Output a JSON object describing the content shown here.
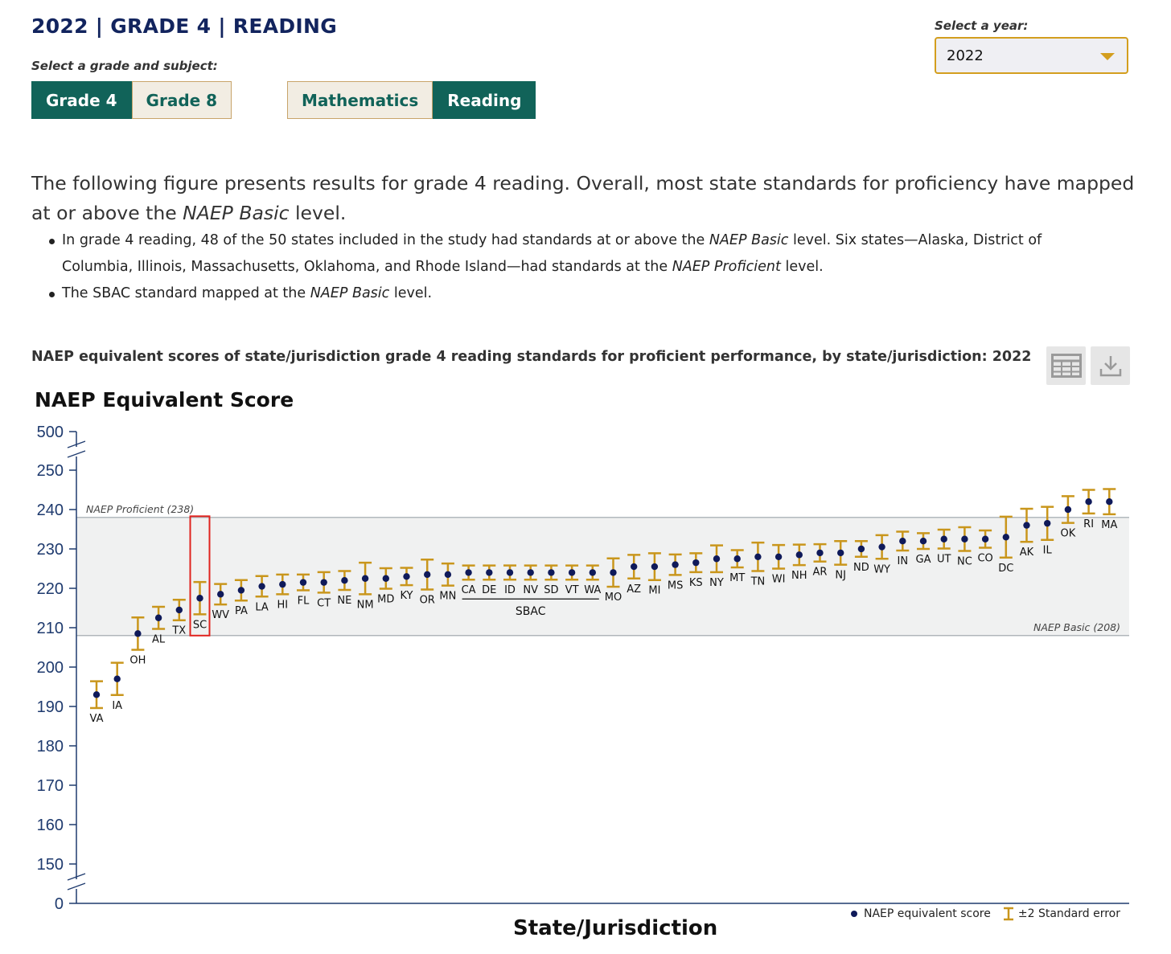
{
  "header": {
    "title": "2022 | GRADE 4 | READING",
    "grade_subject_label": "Select a grade and subject:",
    "year_label": "Select a year:",
    "year_value": "2022",
    "grades": [
      {
        "label": "Grade 4",
        "active": true
      },
      {
        "label": "Grade 8",
        "active": false
      }
    ],
    "subjects": [
      {
        "label": "Mathematics",
        "active": false
      },
      {
        "label": "Reading",
        "active": true
      }
    ]
  },
  "intro": {
    "text_before": "The following figure presents results for grade 4 reading. Overall, most state standards for proficiency have mapped at or above the ",
    "text_em": "NAEP Basic",
    "text_after": " level.",
    "bullet1_a": "In grade 4 reading, 48 of the 50 states included in the study had standards at or above the ",
    "bullet1_em1": "NAEP Basic",
    "bullet1_b": " level. Six states—Alaska, District of Columbia, Illinois, Massachusetts, Oklahoma, and Rhode Island—had standards at the ",
    "bullet1_em2": "NAEP Proficient",
    "bullet1_c": " level.",
    "bullet2_a": "The SBAC standard mapped at the ",
    "bullet2_em": "NAEP Basic",
    "bullet2_b": " level."
  },
  "figure": {
    "caption": "NAEP equivalent scores of state/jurisdiction grade 4 reading standards for proficient performance, by state/jurisdiction: 2022",
    "table_icon": "table-icon",
    "download_icon": "download-icon"
  },
  "colors": {
    "point": "#0f1a5a",
    "error_bar": "#c9961c",
    "band": "#f0f1f1",
    "axis": "#1e3a6e",
    "highlight": "#e0231f"
  },
  "chart_data": {
    "type": "scatter",
    "title": "",
    "ylabel": "NAEP Equivalent Score",
    "xlabel": "State/Jurisdiction",
    "ylim": [
      0,
      500
    ],
    "y_axis_break": true,
    "y_ticks": [
      0,
      150,
      160,
      170,
      180,
      190,
      200,
      210,
      220,
      230,
      240,
      250,
      500
    ],
    "reference_lines": [
      {
        "label": "NAEP Proficient (238)",
        "value": 238
      },
      {
        "label": "NAEP Basic (208)",
        "value": 208
      }
    ],
    "group_label": {
      "label": "SBAC",
      "members": [
        "CA",
        "DE",
        "ID",
        "NV",
        "SD",
        "VT",
        "WA"
      ]
    },
    "highlighted": "SC",
    "legend": {
      "point_label": "NAEP equivalent score",
      "error_label": "±2 Standard error"
    },
    "points": [
      {
        "state": "VA",
        "score": 193,
        "se2": 3.4
      },
      {
        "state": "IA",
        "score": 197,
        "se2": 4.1
      },
      {
        "state": "OH",
        "score": 208.5,
        "se2": 4.1
      },
      {
        "state": "AL",
        "score": 212.5,
        "se2": 2.8
      },
      {
        "state": "TX",
        "score": 214.5,
        "se2": 2.6
      },
      {
        "state": "SC",
        "score": 217.5,
        "se2": 4.1
      },
      {
        "state": "WV",
        "score": 218.5,
        "se2": 2.6
      },
      {
        "state": "PA",
        "score": 219.5,
        "se2": 2.6
      },
      {
        "state": "LA",
        "score": 220.5,
        "se2": 2.6
      },
      {
        "state": "HI",
        "score": 221,
        "se2": 2.5
      },
      {
        "state": "FL",
        "score": 221.5,
        "se2": 2
      },
      {
        "state": "CT",
        "score": 221.5,
        "se2": 2.6
      },
      {
        "state": "NE",
        "score": 222,
        "se2": 2.4
      },
      {
        "state": "NM",
        "score": 222.5,
        "se2": 4
      },
      {
        "state": "MD",
        "score": 222.5,
        "se2": 2.6
      },
      {
        "state": "KY",
        "score": 223,
        "se2": 2.2
      },
      {
        "state": "OR",
        "score": 223.5,
        "se2": 3.8
      },
      {
        "state": "MN",
        "score": 223.5,
        "se2": 2.8
      },
      {
        "state": "CA",
        "score": 224,
        "se2": 1.8
      },
      {
        "state": "DE",
        "score": 224,
        "se2": 1.8
      },
      {
        "state": "ID",
        "score": 224,
        "se2": 1.8
      },
      {
        "state": "NV",
        "score": 224,
        "se2": 1.8
      },
      {
        "state": "SD",
        "score": 224,
        "se2": 1.8
      },
      {
        "state": "VT",
        "score": 224,
        "se2": 1.8
      },
      {
        "state": "WA",
        "score": 224,
        "se2": 1.8
      },
      {
        "state": "MO",
        "score": 224,
        "se2": 3.6
      },
      {
        "state": "AZ",
        "score": 225.5,
        "se2": 3
      },
      {
        "state": "MI",
        "score": 225.5,
        "se2": 3.4
      },
      {
        "state": "MS",
        "score": 226,
        "se2": 2.6
      },
      {
        "state": "KS",
        "score": 226.5,
        "se2": 2.4
      },
      {
        "state": "NY",
        "score": 227.5,
        "se2": 3.4
      },
      {
        "state": "MT",
        "score": 227.5,
        "se2": 2.2
      },
      {
        "state": "TN",
        "score": 228,
        "se2": 3.6
      },
      {
        "state": "WI",
        "score": 228,
        "se2": 3
      },
      {
        "state": "NH",
        "score": 228.5,
        "se2": 2.6
      },
      {
        "state": "AR",
        "score": 229,
        "se2": 2.2
      },
      {
        "state": "NJ",
        "score": 229,
        "se2": 3
      },
      {
        "state": "ND",
        "score": 230,
        "se2": 2
      },
      {
        "state": "WY",
        "score": 230.5,
        "se2": 3
      },
      {
        "state": "IN",
        "score": 232,
        "se2": 2.4
      },
      {
        "state": "GA",
        "score": 232,
        "se2": 2
      },
      {
        "state": "UT",
        "score": 232.5,
        "se2": 2.4
      },
      {
        "state": "NC",
        "score": 232.5,
        "se2": 3
      },
      {
        "state": "CO",
        "score": 232.5,
        "se2": 2.2
      },
      {
        "state": "DC",
        "score": 233,
        "se2": 5.2
      },
      {
        "state": "AK",
        "score": 236,
        "se2": 4.2
      },
      {
        "state": "IL",
        "score": 236.5,
        "se2": 4.2
      },
      {
        "state": "OK",
        "score": 240,
        "se2": 3.4
      },
      {
        "state": "RI",
        "score": 242,
        "se2": 3
      },
      {
        "state": "MA",
        "score": 242,
        "se2": 3.2
      }
    ]
  }
}
